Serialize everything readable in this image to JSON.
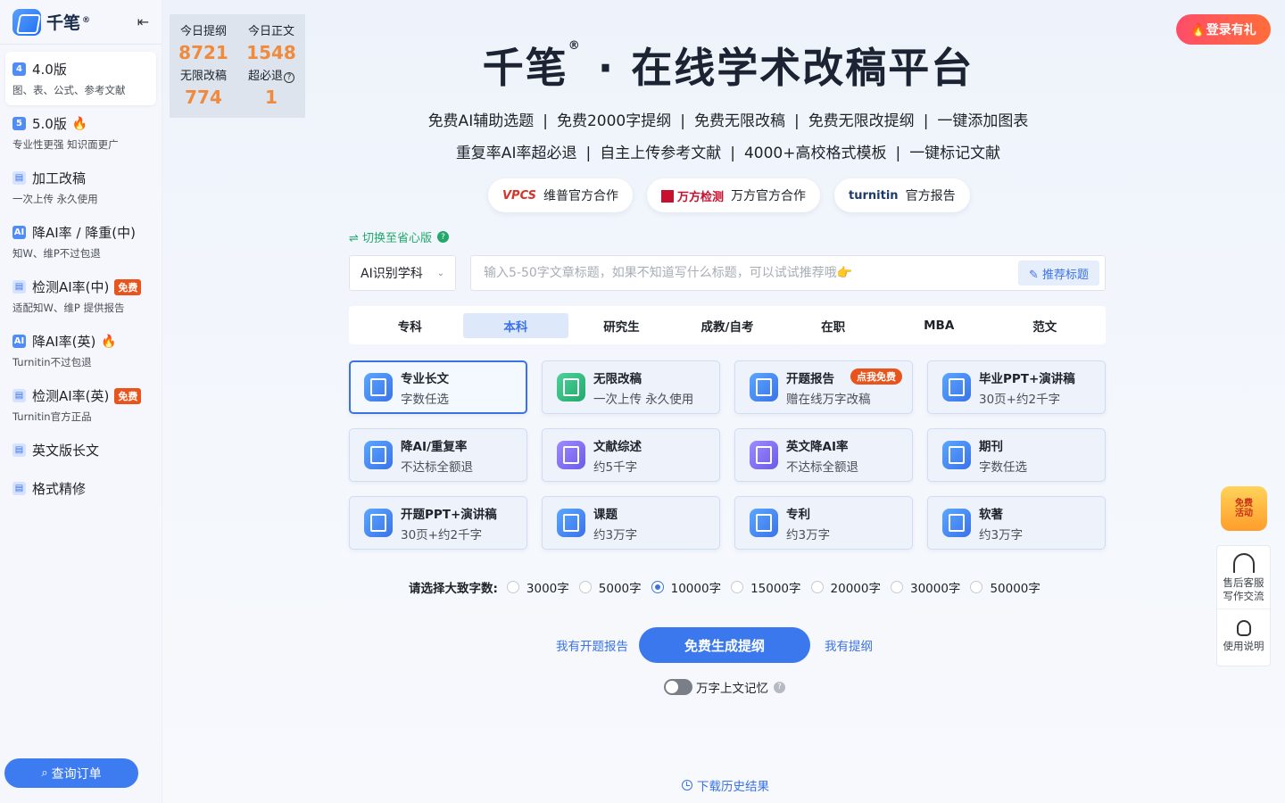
{
  "sidebar": {
    "brand": "千笔",
    "brand_reg": "®",
    "items": [
      {
        "title": "4.0版",
        "sub": "图、表、公式、参考文献",
        "icon": "4",
        "fire": false,
        "free": false
      },
      {
        "title": "5.0版",
        "sub": "专业性更强 知识面更广",
        "icon": "5",
        "fire": true,
        "free": false
      },
      {
        "title": "加工改稿",
        "sub": "一次上传 永久使用",
        "icon": "",
        "fire": false,
        "free": false
      },
      {
        "title": "降AI率 / 降重(中)",
        "sub": "知W、维P不过包退",
        "icon": "AI",
        "fire": false,
        "free": false
      },
      {
        "title": "检测AI率(中)",
        "sub": "适配知W、维P 提供报告",
        "icon": "",
        "fire": false,
        "free": true
      },
      {
        "title": "降AI率(英)",
        "sub": "Turnitin不过包退",
        "icon": "AI",
        "fire": true,
        "free": false
      },
      {
        "title": "检测AI率(英)",
        "sub": "Turnitin官方正品",
        "icon": "",
        "fire": false,
        "free": true
      },
      {
        "title": "英文版长文",
        "sub": "",
        "icon": "",
        "fire": false,
        "free": false
      },
      {
        "title": "格式精修",
        "sub": "",
        "icon": "",
        "fire": false,
        "free": false
      }
    ],
    "free_label": "免费",
    "fire_glyph": "🔥",
    "query_button": "查询订单"
  },
  "stats": {
    "today_outline_label": "今日提纲",
    "today_outline_value": "8721",
    "today_text_label": "今日正文",
    "today_text_value": "1548",
    "unlimited_label": "无限改稿",
    "unlimited_value": "774",
    "refund_label": "超必退",
    "refund_value": "1"
  },
  "header": {
    "login_button": "🔥登录有礼",
    "title_brand": "千笔",
    "title_reg": "®",
    "title_rest": " · 在线学术改稿平台",
    "features_line1": [
      "免费AI辅助选题",
      "免费2000字提纲",
      "免费无限改稿",
      "免费无限改提纲",
      "一键添加图表"
    ],
    "features_line2": [
      "重复率AI率超必退",
      "自主上传参考文献",
      "4000+高校格式模板",
      "一键标记文献"
    ],
    "separator": "|"
  },
  "partners": [
    {
      "logo": "VPCS",
      "label": "维普官方合作"
    },
    {
      "logo": "万方检测",
      "label": "万方官方合作"
    },
    {
      "logo": "turnitin",
      "label": "官方报告"
    }
  ],
  "form": {
    "switch_label": "⇌ 切换至省心版",
    "subject_value": "AI识别学科",
    "title_placeholder": "输入5-50字文章标题，如果不知道写什么标题，可以试试推荐哦👉",
    "recommend_button": "推荐标题",
    "levels": [
      "专科",
      "本科",
      "研究生",
      "成教/自考",
      "在职",
      "MBA",
      "范文"
    ],
    "active_level": 1,
    "types": [
      {
        "name": "专业长文",
        "desc": "字数任选",
        "badge": "",
        "color": "blue",
        "selected": true
      },
      {
        "name": "无限改稿",
        "desc": "一次上传 永久使用",
        "badge": "",
        "color": "green",
        "selected": false
      },
      {
        "name": "开题报告",
        "desc": "赠在线万字改稿",
        "badge": "点我免费",
        "color": "blue",
        "selected": false
      },
      {
        "name": "毕业PPT+演讲稿",
        "desc": "30页+约2千字",
        "badge": "",
        "color": "blue",
        "selected": false
      },
      {
        "name": "降AI/重复率",
        "desc": "不达标全额退",
        "badge": "",
        "color": "blue",
        "selected": false
      },
      {
        "name": "文献综述",
        "desc": "约5千字",
        "badge": "",
        "color": "purple",
        "selected": false
      },
      {
        "name": "英文降AI率",
        "desc": "不达标全额退",
        "badge": "",
        "color": "purple",
        "selected": false
      },
      {
        "name": "期刊",
        "desc": "字数任选",
        "badge": "",
        "color": "blue",
        "selected": false
      },
      {
        "name": "开题PPT+演讲稿",
        "desc": "30页+约2千字",
        "badge": "",
        "color": "blue",
        "selected": false
      },
      {
        "name": "课题",
        "desc": "约3万字",
        "badge": "",
        "color": "blue",
        "selected": false
      },
      {
        "name": "专利",
        "desc": "约3万字",
        "badge": "",
        "color": "blue",
        "selected": false
      },
      {
        "name": "软著",
        "desc": "约3万字",
        "badge": "",
        "color": "blue",
        "selected": false
      }
    ],
    "word_count_label": "请选择大致字数:",
    "word_counts": [
      "3000字",
      "5000字",
      "10000字",
      "15000字",
      "20000字",
      "30000字",
      "50000字"
    ],
    "selected_word_count": 2,
    "have_proposal_link": "我有开题报告",
    "generate_button": "免费生成提纲",
    "have_outline_link": "我有提纲",
    "memory_label": "万字上文记忆",
    "history_link": "下载历史结果"
  },
  "right_panel": {
    "promo": "免费活动",
    "support_label": "售后客服写作交流",
    "support_line1": "售后客服",
    "support_line2": "写作交流",
    "guide_label": "使用说明"
  }
}
